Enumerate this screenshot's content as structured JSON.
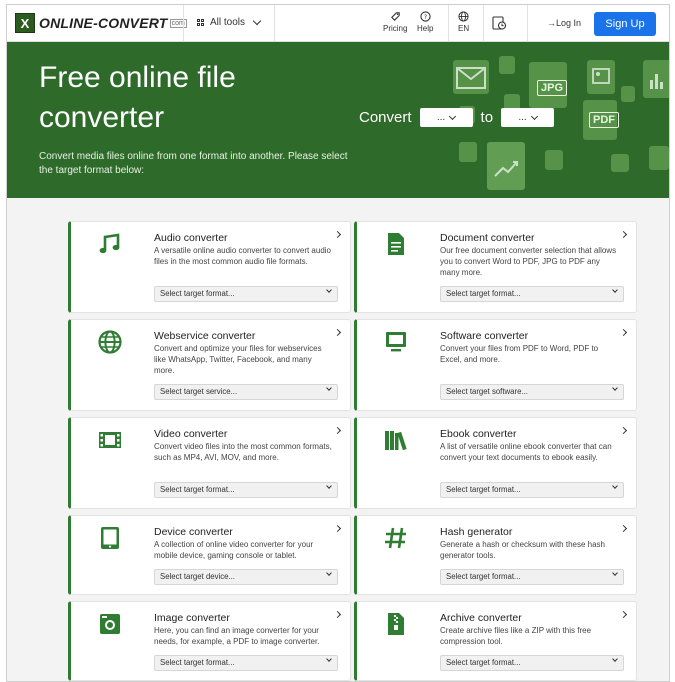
{
  "header": {
    "logo_text": "ONLINE-CONVERT",
    "logo_suffix": "com",
    "all_tools": "All tools",
    "pricing": "Pricing",
    "help": "Help",
    "language": "EN",
    "history_icon": "history-icon",
    "login": "Log In",
    "signup": "Sign Up",
    "colors": {
      "signup_bg": "#1a73e8",
      "brand_green": "#2e7d32"
    }
  },
  "hero": {
    "title": "Free online file converter",
    "subtitle": "Convert media files online from one format into another. Please select the target format below:",
    "convert_label": "Convert",
    "to_label": "to",
    "from_value": "...",
    "to_value": "...",
    "bg_color": "#2e6b2a",
    "deco_labels": [
      "JPG",
      "PDF"
    ]
  },
  "cards": [
    {
      "title": "Audio converter",
      "desc": "A versatile online audio converter to convert audio files in the most common audio file formats.",
      "select": "Select target format...",
      "icon": "music-note-icon"
    },
    {
      "title": "Document converter",
      "desc": "Our free document converter selection that allows you to convert Word to PDF, JPG to PDF any many more.",
      "select": "Select target format...",
      "icon": "document-icon"
    },
    {
      "title": "Webservice converter",
      "desc": "Convert and optimize your files for webservices like WhatsApp, Twitter, Facebook, and many more.",
      "select": "Select target service...",
      "icon": "globe-icon"
    },
    {
      "title": "Software converter",
      "desc": "Convert your files from PDF to Word, PDF to Excel, and more.",
      "select": "Select target software...",
      "icon": "monitor-icon"
    },
    {
      "title": "Video converter",
      "desc": "Convert video files into the most common formats, such as MP4, AVI, MOV, and more.",
      "select": "Select target format...",
      "icon": "film-icon"
    },
    {
      "title": "Ebook converter",
      "desc": "A list of versatile online ebook converter that can convert your text documents to ebook easily.",
      "select": "Select target format...",
      "icon": "books-icon"
    },
    {
      "title": "Device converter",
      "desc": "A collection of online video converter for your mobile device, gaming console or tablet.",
      "select": "Select target device...",
      "icon": "tablet-icon"
    },
    {
      "title": "Hash generator",
      "desc": "Generate a hash or checksum with these hash generator tools.",
      "select": "Select target format...",
      "icon": "hash-icon"
    },
    {
      "title": "Image converter",
      "desc": "Here, you can find an image converter for your needs, for example, a PDF to image converter.",
      "select": "Select target format...",
      "icon": "camera-icon"
    },
    {
      "title": "Archive converter",
      "desc": "Create archive files like a ZIP with this free compression tool.",
      "select": "Select target format...",
      "icon": "zip-file-icon"
    }
  ]
}
